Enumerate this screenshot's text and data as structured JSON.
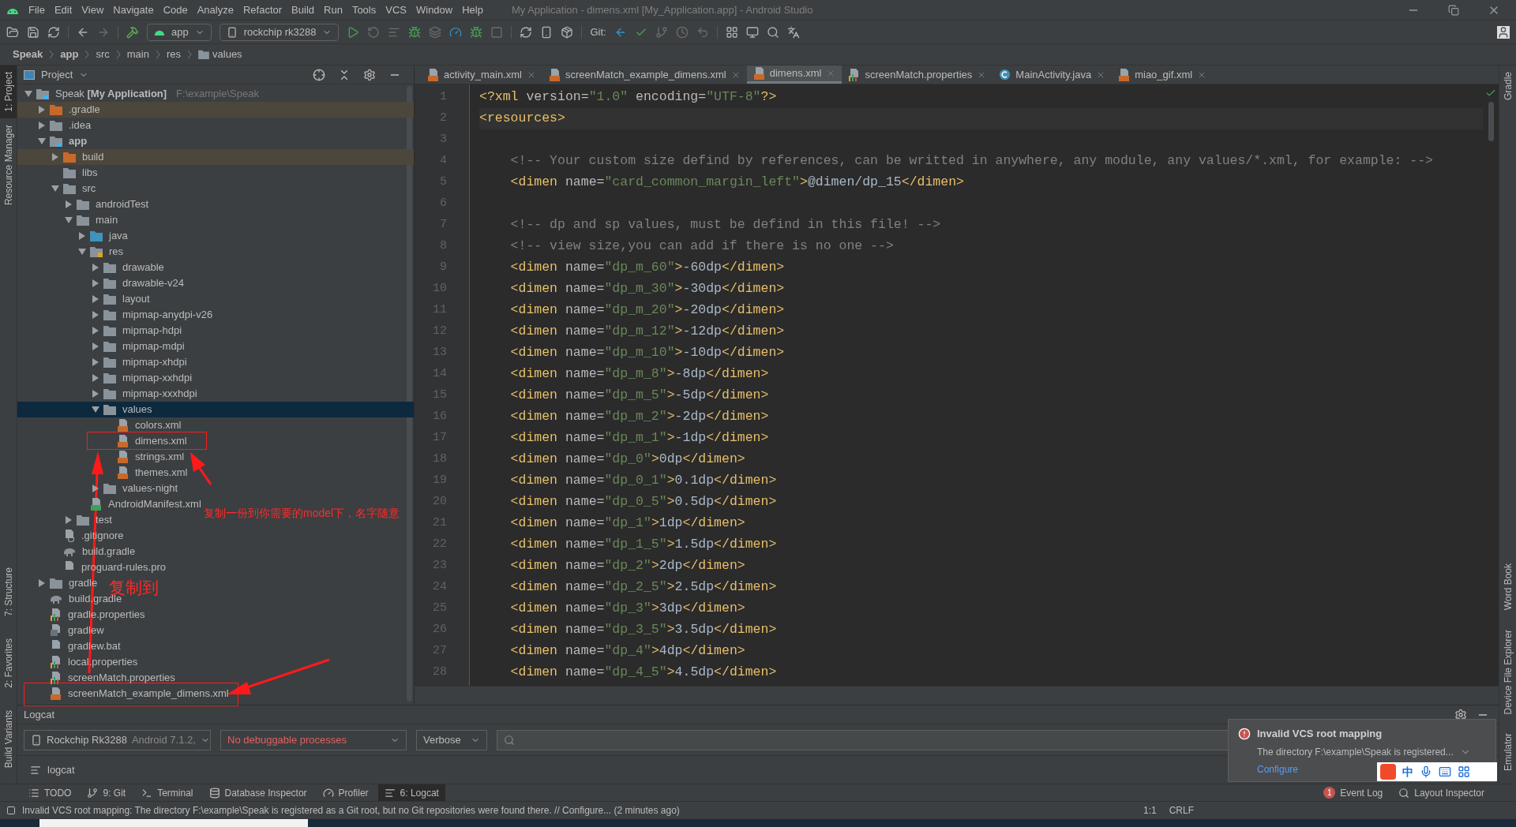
{
  "window": {
    "title": "My Application - dimens.xml [My_Application.app] - Android Studio"
  },
  "menu": [
    "File",
    "Edit",
    "View",
    "Navigate",
    "Code",
    "Analyze",
    "Refactor",
    "Build",
    "Run",
    "Tools",
    "VCS",
    "Window",
    "Help"
  ],
  "toolbar": {
    "config": "app",
    "device": "rockchip rk3288",
    "git_label": "Git:"
  },
  "breadcrumb": [
    {
      "label": "Speak",
      "bold": true
    },
    {
      "label": "app",
      "bold": true
    },
    {
      "label": "src",
      "bold": false
    },
    {
      "label": "main",
      "bold": false
    },
    {
      "label": "res",
      "bold": false
    },
    {
      "label": "values",
      "bold": false,
      "folder": true
    }
  ],
  "left_strip": [
    {
      "label": "1: Project",
      "selected": true
    },
    {
      "label": "Resource Manager",
      "selected": false
    },
    {
      "label": "7: Structure",
      "selected": false
    },
    {
      "label": "2: Favorites",
      "selected": false
    },
    {
      "label": "Build Variants",
      "selected": false
    }
  ],
  "right_strip": [
    {
      "label": "Gradle"
    },
    {
      "label": "Word Book"
    },
    {
      "label": "Device File Explorer"
    },
    {
      "label": "Emulator"
    }
  ],
  "project": {
    "title": "Project",
    "tree": [
      {
        "label": "Speak **[My Application]**",
        "path": "F:\\example\\Speak",
        "kind": "module",
        "expanded": true,
        "bold": false,
        "ignored": false,
        "selected": false,
        "children": [
          {
            "label": ".gradle",
            "kind": "folder-orange",
            "expanded": false,
            "bold": false,
            "ignored": true,
            "selected": false
          },
          {
            "label": ".idea",
            "kind": "folder",
            "expanded": false,
            "bold": false,
            "ignored": false,
            "selected": false
          },
          {
            "label": "app",
            "kind": "module",
            "expanded": true,
            "bold": true,
            "ignored": false,
            "selected": false,
            "children": [
              {
                "label": "build",
                "kind": "folder-orange",
                "expanded": false,
                "bold": false,
                "ignored": true,
                "selected": false
              },
              {
                "label": "libs",
                "kind": "folder",
                "bold": false,
                "ignored": false,
                "selected": false
              },
              {
                "label": "src",
                "kind": "folder",
                "expanded": true,
                "bold": false,
                "ignored": false,
                "selected": false,
                "children": [
                  {
                    "label": "androidTest",
                    "kind": "folder",
                    "expanded": false,
                    "bold": false,
                    "ignored": false,
                    "selected": false
                  },
                  {
                    "label": "main",
                    "kind": "folder",
                    "expanded": true,
                    "bold": false,
                    "ignored": false,
                    "selected": false,
                    "children": [
                      {
                        "label": "java",
                        "kind": "folder-blue",
                        "expanded": false,
                        "bold": false,
                        "ignored": false,
                        "selected": false
                      },
                      {
                        "label": "res",
                        "kind": "folder-res",
                        "expanded": true,
                        "bold": false,
                        "ignored": false,
                        "selected": false,
                        "children": [
                          {
                            "label": "drawable",
                            "kind": "folder",
                            "expanded": false,
                            "bold": false,
                            "ignored": false,
                            "selected": false
                          },
                          {
                            "label": "drawable-v24",
                            "kind": "folder",
                            "expanded": false,
                            "bold": false,
                            "ignored": false,
                            "selected": false
                          },
                          {
                            "label": "layout",
                            "kind": "folder",
                            "expanded": false,
                            "bold": false,
                            "ignored": false,
                            "selected": false
                          },
                          {
                            "label": "mipmap-anydpi-v26",
                            "kind": "folder",
                            "expanded": false,
                            "bold": false,
                            "ignored": false,
                            "selected": false
                          },
                          {
                            "label": "mipmap-hdpi",
                            "kind": "folder",
                            "expanded": false,
                            "bold": false,
                            "ignored": false,
                            "selected": false
                          },
                          {
                            "label": "mipmap-mdpi",
                            "kind": "folder",
                            "expanded": false,
                            "bold": false,
                            "ignored": false,
                            "selected": false
                          },
                          {
                            "label": "mipmap-xhdpi",
                            "kind": "folder",
                            "expanded": false,
                            "bold": false,
                            "ignored": false,
                            "selected": false
                          },
                          {
                            "label": "mipmap-xxhdpi",
                            "kind": "folder",
                            "expanded": false,
                            "bold": false,
                            "ignored": false,
                            "selected": false
                          },
                          {
                            "label": "mipmap-xxxhdpi",
                            "kind": "folder",
                            "expanded": false,
                            "bold": false,
                            "ignored": false,
                            "selected": false
                          },
                          {
                            "label": "values",
                            "kind": "folder",
                            "expanded": true,
                            "bold": false,
                            "ignored": false,
                            "selected": true,
                            "children": [
                              {
                                "label": "colors.xml",
                                "kind": "xml",
                                "bold": false,
                                "ignored": false,
                                "selected": false
                              },
                              {
                                "label": "dimens.xml",
                                "kind": "xml",
                                "bold": false,
                                "ignored": false,
                                "selected": false
                              },
                              {
                                "label": "strings.xml",
                                "kind": "xml",
                                "bold": false,
                                "ignored": false,
                                "selected": false
                              },
                              {
                                "label": "themes.xml",
                                "kind": "xml",
                                "bold": false,
                                "ignored": false,
                                "selected": false
                              }
                            ]
                          },
                          {
                            "label": "values-night",
                            "kind": "folder",
                            "expanded": false,
                            "bold": false,
                            "ignored": false,
                            "selected": false
                          }
                        ]
                      },
                      {
                        "label": "AndroidManifest.xml",
                        "kind": "manifest",
                        "bold": false,
                        "ignored": false,
                        "selected": false
                      }
                    ]
                  },
                  {
                    "label": "test",
                    "kind": "folder",
                    "expanded": false,
                    "bold": false,
                    "ignored": false,
                    "selected": false
                  }
                ]
              },
              {
                "label": ".gitignore",
                "kind": "gitignore",
                "bold": false,
                "ignored": false,
                "selected": false
              },
              {
                "label": "build.gradle",
                "kind": "gradle",
                "bold": false,
                "ignored": false,
                "selected": false
              },
              {
                "label": "proguard-rules.pro",
                "kind": "text",
                "bold": false,
                "ignored": false,
                "selected": false
              }
            ]
          },
          {
            "label": "gradle",
            "kind": "folder",
            "expanded": false,
            "bold": false,
            "ignored": false,
            "selected": false
          },
          {
            "label": "build.gradle",
            "kind": "gradle",
            "bold": false,
            "ignored": false,
            "selected": false
          },
          {
            "label": "gradle.properties",
            "kind": "properties",
            "bold": false,
            "ignored": false,
            "selected": false
          },
          {
            "label": "gradlew",
            "kind": "script",
            "bold": false,
            "ignored": false,
            "selected": false
          },
          {
            "label": "gradlew.bat",
            "kind": "text",
            "bold": false,
            "ignored": false,
            "selected": false
          },
          {
            "label": "local.properties",
            "kind": "properties",
            "bold": false,
            "ignored": false,
            "selected": false
          },
          {
            "label": "screenMatch.properties",
            "kind": "properties",
            "bold": false,
            "ignored": false,
            "selected": false
          },
          {
            "label": "screenMatch_example_dimens.xml",
            "kind": "xml",
            "bold": false,
            "ignored": false,
            "selected": false
          }
        ]
      }
    ]
  },
  "editor": {
    "tabs": [
      {
        "label": "activity_main.xml",
        "kind": "xml",
        "selected": false
      },
      {
        "label": "screenMatch_example_dimens.xml",
        "kind": "xml",
        "selected": false
      },
      {
        "label": "dimens.xml",
        "kind": "xml",
        "selected": true
      },
      {
        "label": "screenMatch.properties",
        "kind": "properties",
        "selected": false
      },
      {
        "label": "MainActivity.java",
        "kind": "java",
        "selected": false
      },
      {
        "label": "miao_gif.xml",
        "kind": "xml",
        "selected": false
      }
    ],
    "lines": [
      {
        "n": "1",
        "text": "<?xml version=\"1.0\" encoding=\"UTF-8\"?>"
      },
      {
        "n": "2",
        "text": "<resources>"
      },
      {
        "n": "3"
      },
      {
        "n": "4",
        "text": "    <!-- Your custom size defind by references, can be writted in anywhere, any module, any values/*.xml, for example: -->"
      },
      {
        "n": "5",
        "text": "    <dimen name=\"card_common_margin_left\">@dimen/dp_15</dimen>"
      },
      {
        "n": "6"
      },
      {
        "n": "7",
        "text": "    <!-- dp and sp values, must be defind in this file! -->"
      },
      {
        "n": "8",
        "text": "    <!-- view size,you can add if there is no one -->"
      },
      {
        "n": "9",
        "text": "    <dimen name=\"dp_m_60\">-60dp</dimen>"
      },
      {
        "n": "10",
        "text": "    <dimen name=\"dp_m_30\">-30dp</dimen>"
      },
      {
        "n": "11",
        "text": "    <dimen name=\"dp_m_20\">-20dp</dimen>"
      },
      {
        "n": "12",
        "text": "    <dimen name=\"dp_m_12\">-12dp</dimen>"
      },
      {
        "n": "13",
        "text": "    <dimen name=\"dp_m_10\">-10dp</dimen>"
      },
      {
        "n": "14",
        "text": "    <dimen name=\"dp_m_8\">-8dp</dimen>"
      },
      {
        "n": "15",
        "text": "    <dimen name=\"dp_m_5\">-5dp</dimen>"
      },
      {
        "n": "16",
        "text": "    <dimen name=\"dp_m_2\">-2dp</dimen>"
      },
      {
        "n": "17",
        "text": "    <dimen name=\"dp_m_1\">-1dp</dimen>"
      },
      {
        "n": "18",
        "text": "    <dimen name=\"dp_0\">0dp</dimen>"
      },
      {
        "n": "19",
        "text": "    <dimen name=\"dp_0_1\">0.1dp</dimen>"
      },
      {
        "n": "20",
        "text": "    <dimen name=\"dp_0_5\">0.5dp</dimen>"
      },
      {
        "n": "21",
        "text": "    <dimen name=\"dp_1\">1dp</dimen>"
      },
      {
        "n": "22",
        "text": "    <dimen name=\"dp_1_5\">1.5dp</dimen>"
      },
      {
        "n": "23",
        "text": "    <dimen name=\"dp_2\">2dp</dimen>"
      },
      {
        "n": "24",
        "text": "    <dimen name=\"dp_2_5\">2.5dp</dimen>"
      },
      {
        "n": "25",
        "text": "    <dimen name=\"dp_3\">3dp</dimen>"
      },
      {
        "n": "26",
        "text": "    <dimen name=\"dp_3_5\">3.5dp</dimen>"
      },
      {
        "n": "27",
        "text": "    <dimen name=\"dp_4\">4dp</dimen>"
      },
      {
        "n": "28",
        "text": "    <dimen name=\"dp_4_5\">4.5dp</dimen>"
      }
    ]
  },
  "logcat": {
    "title": "Logcat",
    "device": "Rockchip Rk3288",
    "device_detail": "Android 7.1.2,",
    "process": "No debuggable processes",
    "level": "Verbose",
    "tab": "logcat"
  },
  "tool_tabs": [
    {
      "label": "TODO",
      "selected": false
    },
    {
      "label": "9: Git",
      "selected": false
    },
    {
      "label": "Terminal",
      "selected": false
    },
    {
      "label": "Database Inspector",
      "selected": false
    },
    {
      "label": "Profiler",
      "selected": false
    },
    {
      "label": "6: Logcat",
      "selected": true
    }
  ],
  "tool_tabs_right": [
    {
      "label": "Event Log",
      "badge": "1"
    },
    {
      "label": "Layout Inspector"
    }
  ],
  "status_bar": {
    "message": "Invalid VCS root mapping: The directory F:\\example\\Speak is registered as a Git root, but no Git repositories were found there. // Configure... (2 minutes ago)",
    "position": "1:1",
    "line_ending": "CRLF"
  },
  "notification": {
    "title": "Invalid VCS root mapping",
    "body": "The directory F:\\example\\Speak is registered...",
    "link": "Configure"
  },
  "ime_bar": {
    "lang": "中"
  },
  "annotations": {
    "note": "复制一份到你需要的model下，名字随意",
    "copy_to": "复制到"
  }
}
